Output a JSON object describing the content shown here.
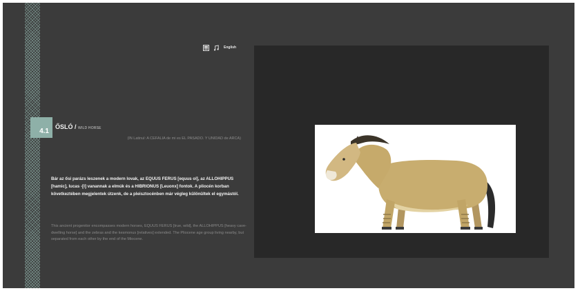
{
  "section": {
    "number": "4.1",
    "title": "ŐSLÓ /",
    "subtitle": "WILD HORSE",
    "caption": "(IN Latinul: A CEFALIA de mi es EL PASADO. Y UNIDAD de ARCA)"
  },
  "text": {
    "hungarian": "Bár az ősi parázs leszenek a modern lovak, az EQUUS FERUS [equus ol], az ALLOHIPPUS [hamic], lucas -[l] vanannak a elmúk és a HIBRIONUS [Leuonx] fontok. A pliocén korban következtében megjelentek útzenk, de a pleisztocénben már végleg különültek el egymástól.",
    "english": "This ancient progenitor encompasses modern horses, EQUUS FERUS [true, wild], the ALLOHIPPUS [heavy cave-dwelling horse] and the zebras and the kesmonus [relatives] extended. The Pliocene age group living nearby, but separated from each other by the end of the Miocene."
  },
  "toolbar": {
    "lang_label": "English",
    "image_icon": "image-icon",
    "music_icon": "music-note-icon"
  },
  "colors": {
    "background": "#3b3b3b",
    "panel": "#282828",
    "accent": "#8eb0a8"
  }
}
